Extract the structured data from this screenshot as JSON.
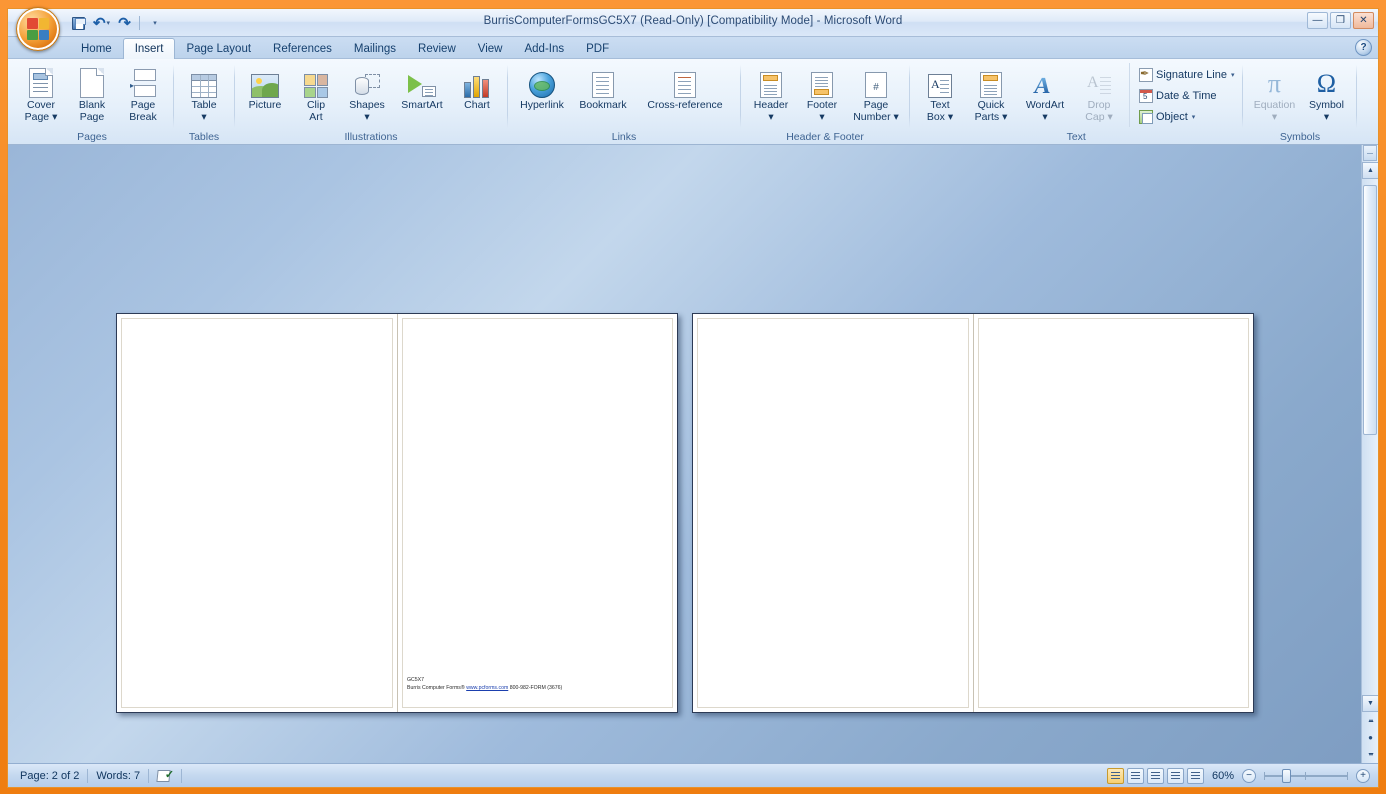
{
  "window": {
    "title": "BurrisComputerFormsGC5X7 (Read-Only) [Compatibility Mode] - Microsoft Word",
    "minimize_label": "—",
    "restore_label": "❐",
    "close_label": "✕",
    "help_label": "?"
  },
  "quick_access": {
    "office_button": "office-button",
    "items": [
      {
        "name": "save",
        "label": "Save"
      },
      {
        "name": "undo",
        "label": "Undo",
        "glyph": "↶"
      },
      {
        "name": "redo",
        "label": "Redo",
        "glyph": "↷"
      },
      {
        "name": "customize",
        "label": "Customize Quick Access Toolbar",
        "glyph": "▾"
      }
    ]
  },
  "tabs": [
    {
      "label": "Home",
      "active": false
    },
    {
      "label": "Insert",
      "active": true
    },
    {
      "label": "Page Layout",
      "active": false
    },
    {
      "label": "References",
      "active": false
    },
    {
      "label": "Mailings",
      "active": false
    },
    {
      "label": "Review",
      "active": false
    },
    {
      "label": "View",
      "active": false
    },
    {
      "label": "Add-Ins",
      "active": false
    },
    {
      "label": "PDF",
      "active": false
    }
  ],
  "ribbon": {
    "groups": [
      {
        "label": "Pages",
        "buttons": [
          {
            "label_line1": "Cover",
            "label_line2": "Page",
            "has_caret": true,
            "enabled": true
          },
          {
            "label_line1": "Blank",
            "label_line2": "Page",
            "has_caret": false,
            "enabled": true
          },
          {
            "label_line1": "Page",
            "label_line2": "Break",
            "has_caret": false,
            "enabled": true
          }
        ]
      },
      {
        "label": "Tables",
        "buttons": [
          {
            "label_line1": "Table",
            "label_line2": "",
            "has_caret": true,
            "enabled": true
          }
        ]
      },
      {
        "label": "Illustrations",
        "buttons": [
          {
            "label_line1": "Picture",
            "label_line2": "",
            "has_caret": false,
            "enabled": true
          },
          {
            "label_line1": "Clip",
            "label_line2": "Art",
            "has_caret": false,
            "enabled": true
          },
          {
            "label_line1": "Shapes",
            "label_line2": "",
            "has_caret": true,
            "enabled": true
          },
          {
            "label_line1": "SmartArt",
            "label_line2": "",
            "has_caret": false,
            "enabled": true
          },
          {
            "label_line1": "Chart",
            "label_line2": "",
            "has_caret": false,
            "enabled": true
          }
        ]
      },
      {
        "label": "Links",
        "buttons": [
          {
            "label_line1": "Hyperlink",
            "label_line2": "",
            "has_caret": false,
            "enabled": true
          },
          {
            "label_line1": "Bookmark",
            "label_line2": "",
            "has_caret": false,
            "enabled": true
          },
          {
            "label_line1": "Cross-reference",
            "label_line2": "",
            "has_caret": false,
            "enabled": true
          }
        ]
      },
      {
        "label": "Header & Footer",
        "buttons": [
          {
            "label_line1": "Header",
            "label_line2": "",
            "has_caret": true,
            "enabled": true
          },
          {
            "label_line1": "Footer",
            "label_line2": "",
            "has_caret": true,
            "enabled": true
          },
          {
            "label_line1": "Page",
            "label_line2": "Number",
            "has_caret": true,
            "enabled": true
          }
        ]
      },
      {
        "label": "Text",
        "buttons": [
          {
            "label_line1": "Text",
            "label_line2": "Box",
            "has_caret": true,
            "enabled": true
          },
          {
            "label_line1": "Quick",
            "label_line2": "Parts",
            "has_caret": true,
            "enabled": true
          },
          {
            "label_line1": "WordArt",
            "label_line2": "",
            "has_caret": true,
            "enabled": true
          },
          {
            "label_line1": "Drop",
            "label_line2": "Cap",
            "has_caret": true,
            "enabled": false
          }
        ],
        "small_buttons": [
          {
            "label": "Signature Line",
            "has_caret": true,
            "enabled": true
          },
          {
            "label": "Date & Time",
            "has_caret": false,
            "enabled": true
          },
          {
            "label": "Object",
            "has_caret": true,
            "enabled": true
          }
        ]
      },
      {
        "label": "Symbols",
        "buttons": [
          {
            "label_line1": "Equation",
            "label_line2": "",
            "has_caret": true,
            "enabled": false
          },
          {
            "label_line1": "Symbol",
            "label_line2": "",
            "has_caret": true,
            "enabled": true
          }
        ]
      }
    ]
  },
  "document": {
    "form_code": "GC5X7",
    "footer_company": "Burris Computer Forms®",
    "footer_link": "www.pcforms.com",
    "footer_phone": "800-982-FORM (3676)",
    "pages": [
      {
        "name": "page-1-left",
        "has_text": false
      },
      {
        "name": "page-1-right",
        "has_text": true
      },
      {
        "name": "page-2-left",
        "has_text": false
      },
      {
        "name": "page-2-right",
        "has_text": false
      }
    ]
  },
  "status": {
    "page_indicator": "Page: 2 of 2",
    "word_count": "Words: 7",
    "proofing_label": "Proofing errors",
    "zoom_level": "60%",
    "zoom_out_label": "−",
    "zoom_in_label": "+",
    "view_buttons": [
      {
        "name": "print-layout",
        "selected": true
      },
      {
        "name": "full-screen-reading",
        "selected": false
      },
      {
        "name": "web-layout",
        "selected": false
      },
      {
        "name": "outline",
        "selected": false
      },
      {
        "name": "draft",
        "selected": false
      }
    ]
  },
  "scrollbar": {
    "up_label": "▲",
    "down_label": "▼",
    "previous_page_label": "▴▴",
    "select_browse_object_label": "●",
    "next_page_label": "▾▾"
  },
  "colors": {
    "frame_orange": "#f08010",
    "accent_blue": "#1e5fa3",
    "ribbon_label": "#3f6492"
  }
}
